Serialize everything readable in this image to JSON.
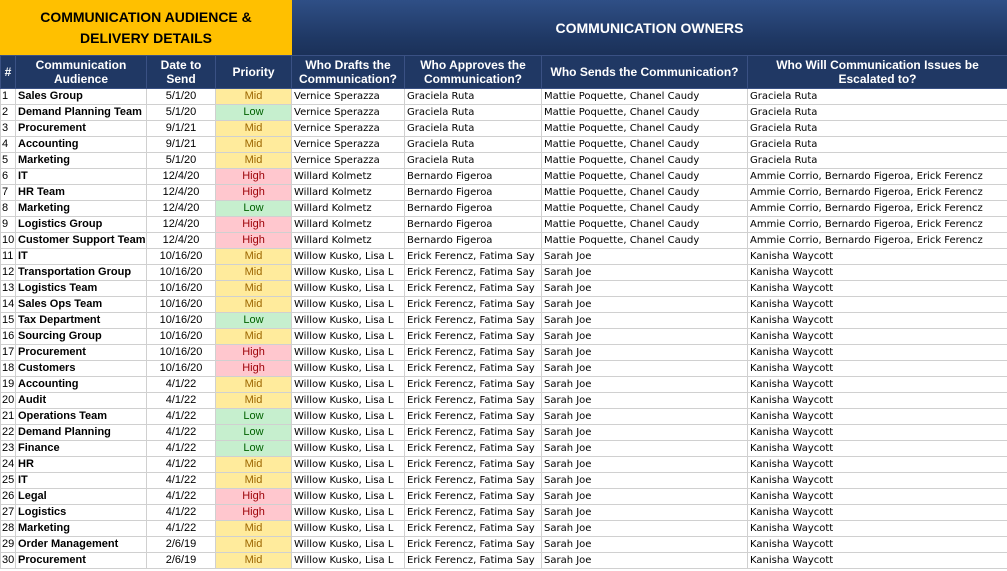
{
  "banner": {
    "left_line1": "COMMUNICATION AUDIENCE &",
    "left_line2": "DELIVERY DETAILS",
    "right": "COMMUNICATION OWNERS"
  },
  "headers": {
    "num": "#",
    "audience": "Communication Audience",
    "date": "Date to Send",
    "priority": "Priority",
    "drafts": "Who Drafts the Communication?",
    "approves": "Who Approves the Communication?",
    "sends": "Who Sends the Communication?",
    "escalated": "Who Will Communication Issues be Escalated to?"
  },
  "colors": {
    "banner_left": "#FFC000",
    "banner_right": "#1F3864",
    "header": "#203864",
    "mid": "#FFEB9C",
    "low": "#C6EFCE",
    "high": "#FFC7CE"
  },
  "rows": [
    {
      "num": "1",
      "audience": "Sales Group",
      "date": "5/1/20",
      "priority": "Mid",
      "drafts": "Vernice Sperazza",
      "approves": "Graciela Ruta",
      "sends": "Mattie Poquette, Chanel Caudy",
      "escalated": "Graciela Ruta"
    },
    {
      "num": "2",
      "audience": "Demand Planning Team",
      "date": "5/1/20",
      "priority": "Low",
      "drafts": "Vernice Sperazza",
      "approves": "Graciela Ruta",
      "sends": "Mattie Poquette, Chanel Caudy",
      "escalated": "Graciela Ruta"
    },
    {
      "num": "3",
      "audience": "Procurement",
      "date": "9/1/21",
      "priority": "Mid",
      "drafts": "Vernice Sperazza",
      "approves": "Graciela Ruta",
      "sends": "Mattie Poquette, Chanel Caudy",
      "escalated": "Graciela Ruta"
    },
    {
      "num": "4",
      "audience": "Accounting",
      "date": "9/1/21",
      "priority": "Mid",
      "drafts": "Vernice Sperazza",
      "approves": "Graciela Ruta",
      "sends": "Mattie Poquette, Chanel Caudy",
      "escalated": "Graciela Ruta"
    },
    {
      "num": "5",
      "audience": "Marketing",
      "date": "5/1/20",
      "priority": "Mid",
      "drafts": "Vernice Sperazza",
      "approves": "Graciela Ruta",
      "sends": "Mattie Poquette, Chanel Caudy",
      "escalated": "Graciela Ruta"
    },
    {
      "num": "6",
      "audience": "IT",
      "date": "12/4/20",
      "priority": "High",
      "drafts": "Willard Kolmetz",
      "approves": "Bernardo Figeroa",
      "sends": "Mattie Poquette, Chanel Caudy",
      "escalated": "Ammie Corrio, Bernardo Figeroa, Erick Ferencz"
    },
    {
      "num": "7",
      "audience": "HR Team",
      "date": "12/4/20",
      "priority": "High",
      "drafts": "Willard Kolmetz",
      "approves": "Bernardo Figeroa",
      "sends": "Mattie Poquette, Chanel Caudy",
      "escalated": "Ammie Corrio, Bernardo Figeroa, Erick Ferencz"
    },
    {
      "num": "8",
      "audience": "Marketing",
      "date": "12/4/20",
      "priority": "Low",
      "drafts": "Willard Kolmetz",
      "approves": "Bernardo Figeroa",
      "sends": "Mattie Poquette, Chanel Caudy",
      "escalated": "Ammie Corrio, Bernardo Figeroa, Erick Ferencz"
    },
    {
      "num": "9",
      "audience": "Logistics Group",
      "date": "12/4/20",
      "priority": "High",
      "drafts": "Willard Kolmetz",
      "approves": "Bernardo Figeroa",
      "sends": "Mattie Poquette, Chanel Caudy",
      "escalated": "Ammie Corrio, Bernardo Figeroa, Erick Ferencz"
    },
    {
      "num": "10",
      "audience": "Customer Support Team",
      "date": "12/4/20",
      "priority": "High",
      "drafts": "Willard Kolmetz",
      "approves": "Bernardo Figeroa",
      "sends": "Mattie Poquette, Chanel Caudy",
      "escalated": "Ammie Corrio, Bernardo Figeroa, Erick Ferencz"
    },
    {
      "num": "11",
      "audience": "IT",
      "date": "10/16/20",
      "priority": "Mid",
      "drafts": "Willow Kusko, Lisa L",
      "approves": "Erick Ferencz, Fatima Say",
      "sends": "Sarah Joe",
      "escalated": "Kanisha Waycott"
    },
    {
      "num": "12",
      "audience": "Transportation Group",
      "date": "10/16/20",
      "priority": "Mid",
      "drafts": "Willow Kusko, Lisa L",
      "approves": "Erick Ferencz, Fatima Say",
      "sends": "Sarah Joe",
      "escalated": "Kanisha Waycott"
    },
    {
      "num": "13",
      "audience": "Logistics Team",
      "date": "10/16/20",
      "priority": "Mid",
      "drafts": "Willow Kusko, Lisa L",
      "approves": "Erick Ferencz, Fatima Say",
      "sends": "Sarah Joe",
      "escalated": "Kanisha Waycott"
    },
    {
      "num": "14",
      "audience": "Sales Ops Team",
      "date": "10/16/20",
      "priority": "Mid",
      "drafts": "Willow Kusko, Lisa L",
      "approves": "Erick Ferencz, Fatima Say",
      "sends": "Sarah Joe",
      "escalated": "Kanisha Waycott"
    },
    {
      "num": "15",
      "audience": "Tax Department",
      "date": "10/16/20",
      "priority": "Low",
      "drafts": "Willow Kusko, Lisa L",
      "approves": "Erick Ferencz, Fatima Say",
      "sends": "Sarah Joe",
      "escalated": "Kanisha Waycott"
    },
    {
      "num": "16",
      "audience": "Sourcing Group",
      "date": "10/16/20",
      "priority": "Mid",
      "drafts": "Willow Kusko, Lisa L",
      "approves": "Erick Ferencz, Fatima Say",
      "sends": "Sarah Joe",
      "escalated": "Kanisha Waycott"
    },
    {
      "num": "17",
      "audience": "Procurement",
      "date": "10/16/20",
      "priority": "High",
      "drafts": "Willow Kusko, Lisa L",
      "approves": "Erick Ferencz, Fatima Say",
      "sends": "Sarah Joe",
      "escalated": "Kanisha Waycott"
    },
    {
      "num": "18",
      "audience": "Customers",
      "date": "10/16/20",
      "priority": "High",
      "drafts": "Willow Kusko, Lisa L",
      "approves": "Erick Ferencz, Fatima Say",
      "sends": "Sarah Joe",
      "escalated": "Kanisha Waycott"
    },
    {
      "num": "19",
      "audience": "Accounting",
      "date": "4/1/22",
      "priority": "Mid",
      "drafts": "Willow Kusko, Lisa L",
      "approves": "Erick Ferencz, Fatima Say",
      "sends": "Sarah Joe",
      "escalated": "Kanisha Waycott"
    },
    {
      "num": "20",
      "audience": "Audit",
      "date": "4/1/22",
      "priority": "Mid",
      "drafts": "Willow Kusko, Lisa L",
      "approves": "Erick Ferencz, Fatima Say",
      "sends": "Sarah Joe",
      "escalated": "Kanisha Waycott"
    },
    {
      "num": "21",
      "audience": "Operations Team",
      "date": "4/1/22",
      "priority": "Low",
      "drafts": "Willow Kusko, Lisa L",
      "approves": "Erick Ferencz, Fatima Say",
      "sends": "Sarah Joe",
      "escalated": "Kanisha Waycott"
    },
    {
      "num": "22",
      "audience": "Demand Planning",
      "date": "4/1/22",
      "priority": "Low",
      "drafts": "Willow Kusko, Lisa L",
      "approves": "Erick Ferencz, Fatima Say",
      "sends": "Sarah Joe",
      "escalated": "Kanisha Waycott"
    },
    {
      "num": "23",
      "audience": "Finance",
      "date": "4/1/22",
      "priority": "Low",
      "drafts": "Willow Kusko, Lisa L",
      "approves": "Erick Ferencz, Fatima Say",
      "sends": "Sarah Joe",
      "escalated": "Kanisha Waycott"
    },
    {
      "num": "24",
      "audience": "HR",
      "date": "4/1/22",
      "priority": "Mid",
      "drafts": "Willow Kusko, Lisa L",
      "approves": "Erick Ferencz, Fatima Say",
      "sends": "Sarah Joe",
      "escalated": "Kanisha Waycott"
    },
    {
      "num": "25",
      "audience": "IT",
      "date": "4/1/22",
      "priority": "Mid",
      "drafts": "Willow Kusko, Lisa L",
      "approves": "Erick Ferencz, Fatima Say",
      "sends": "Sarah Joe",
      "escalated": "Kanisha Waycott"
    },
    {
      "num": "26",
      "audience": "Legal",
      "date": "4/1/22",
      "priority": "High",
      "drafts": "Willow Kusko, Lisa L",
      "approves": "Erick Ferencz, Fatima Say",
      "sends": "Sarah Joe",
      "escalated": "Kanisha Waycott"
    },
    {
      "num": "27",
      "audience": "Logistics",
      "date": "4/1/22",
      "priority": "High",
      "drafts": "Willow Kusko, Lisa L",
      "approves": "Erick Ferencz, Fatima Say",
      "sends": "Sarah Joe",
      "escalated": "Kanisha Waycott"
    },
    {
      "num": "28",
      "audience": "Marketing",
      "date": "4/1/22",
      "priority": "Mid",
      "drafts": "Willow Kusko, Lisa L",
      "approves": "Erick Ferencz, Fatima Say",
      "sends": "Sarah Joe",
      "escalated": "Kanisha Waycott"
    },
    {
      "num": "29",
      "audience": "Order Management",
      "date": "2/6/19",
      "priority": "Mid",
      "drafts": "Willow Kusko, Lisa L",
      "approves": "Erick Ferencz, Fatima Say",
      "sends": "Sarah Joe",
      "escalated": "Kanisha Waycott"
    },
    {
      "num": "30",
      "audience": "Procurement",
      "date": "2/6/19",
      "priority": "Mid",
      "drafts": "Willow Kusko, Lisa L",
      "approves": "Erick Ferencz, Fatima Say",
      "sends": "Sarah Joe",
      "escalated": "Kanisha Waycott"
    }
  ]
}
